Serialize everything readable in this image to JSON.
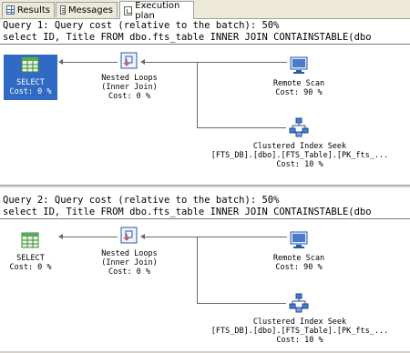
{
  "tabs": [
    {
      "label": "Results",
      "icon": "results-grid-icon"
    },
    {
      "label": "Messages",
      "icon": "messages-icon"
    },
    {
      "label": "Execution plan",
      "icon": "execution-plan-icon",
      "active": true
    }
  ],
  "queries": [
    {
      "header": "Query 1: Query cost (relative to the batch): 50%",
      "sql": "select ID, Title FROM dbo.fts_table INNER JOIN CONTAINSTABLE(dbo",
      "select": {
        "label": "SELECT",
        "cost": "Cost: 0 %",
        "selected": true
      },
      "loops": {
        "title": "Nested Loops",
        "subtitle": "(Inner Join)",
        "cost": "Cost: 0 %"
      },
      "remote": {
        "title": "Remote Scan",
        "cost": "Cost: 90 %"
      },
      "seek": {
        "title": "Clustered Index Seek",
        "object": "[FTS_DB].[dbo].[FTS_Table].[PK_fts_...",
        "cost": "Cost: 10 %"
      }
    },
    {
      "header": "Query 2: Query cost (relative to the batch): 50%",
      "sql": "select ID, Title FROM dbo.fts_table INNER JOIN CONTAINSTABLE(dbo",
      "select": {
        "label": "SELECT",
        "cost": "Cost: 0 %",
        "selected": false
      },
      "loops": {
        "title": "Nested Loops",
        "subtitle": "(Inner Join)",
        "cost": "Cost: 0 %"
      },
      "remote": {
        "title": "Remote Scan",
        "cost": "Cost: 90 %"
      },
      "seek": {
        "title": "Clustered Index Seek",
        "object": "[FTS_DB].[dbo].[FTS_Table].[PK_fts_...",
        "cost": "Cost: 10 %"
      }
    }
  ],
  "colors": {
    "selection": "#316ac5",
    "connector": "#6a6a6a",
    "tab_bar": "#ece9d8"
  }
}
